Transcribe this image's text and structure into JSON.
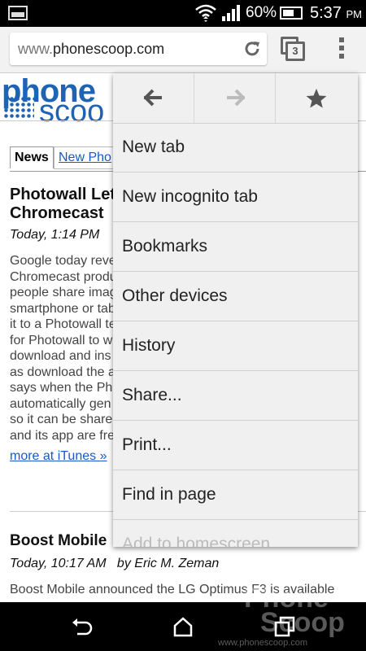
{
  "status_bar": {
    "battery_percent": "60%",
    "time": "5:37",
    "ampm": "PM"
  },
  "browser": {
    "url_prefix": "www.",
    "url_domain": "phonescoop.com",
    "tab_count": "3"
  },
  "page": {
    "logo_line1": "phone",
    "logo_line2": "scoo",
    "tabs": [
      "News",
      "New Pho"
    ],
    "article1": {
      "title": "Photowall Let\nChromecast",
      "meta": "Today, 1:14 PM",
      "body": "Google today reve\nChromecast produ\npeople share imag\nsmartphone or tab\nit to a Photowall te\nfor Photowall to w\ndownload and ins\nas download the a\nsays when the Ph\nautomatically gen\nso it can be share\nand its app are fre",
      "more": "more at iTunes »"
    },
    "article2": {
      "title": "Boost Mobile",
      "meta": "Today, 10:17 AM   by Eric M. Zeman",
      "body": "Boost Mobile announced the LG Optimus F3 is available"
    }
  },
  "menu": {
    "items": [
      "New tab",
      "New incognito tab",
      "Bookmarks",
      "Other devices",
      "History",
      "Share...",
      "Print...",
      "Find in page",
      "Add to homescreen"
    ]
  },
  "watermark": {
    "line1": "Phone",
    "line2": "Scoop",
    "url": "www.phonescoop.com"
  }
}
